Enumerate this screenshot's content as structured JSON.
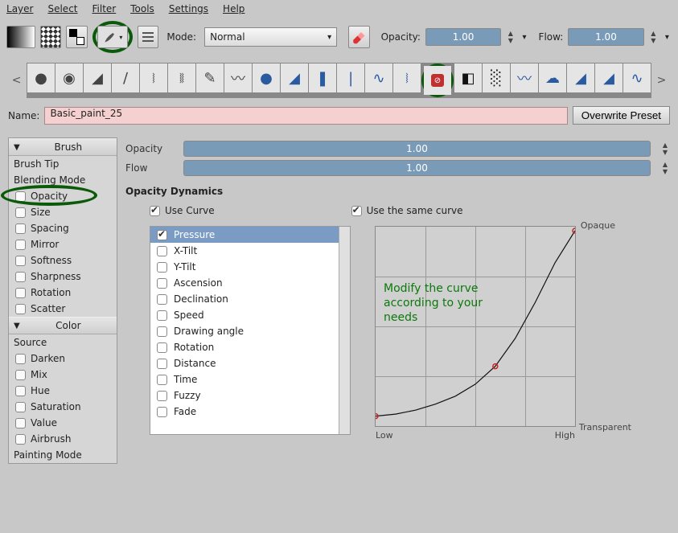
{
  "menubar": [
    "Layer",
    "Select",
    "Filter",
    "Tools",
    "Settings",
    "Help"
  ],
  "toolbar": {
    "mode_label": "Mode:",
    "mode_value": "Normal",
    "opacity_label": "Opacity:",
    "opacity_value": "1.00",
    "flow_label": "Flow:",
    "flow_value": "1.00"
  },
  "name_row": {
    "label": "Name:",
    "value": "Basic_paint_25",
    "overwrite": "Overwrite Preset"
  },
  "left": {
    "brush_header": "Brush",
    "brush_tip": "Brush Tip",
    "blending_mode": "Blending Mode",
    "opacity": "Opacity",
    "size": "Size",
    "spacing": "Spacing",
    "mirror": "Mirror",
    "softness": "Softness",
    "sharpness": "Sharpness",
    "rotation": "Rotation",
    "scatter": "Scatter",
    "color_header": "Color",
    "source": "Source",
    "darken": "Darken",
    "mix": "Mix",
    "hue": "Hue",
    "saturation": "Saturation",
    "value": "Value",
    "airbrush": "Airbrush",
    "painting_mode": "Painting Mode"
  },
  "right": {
    "opacity_label": "Opacity",
    "opacity_value": "1.00",
    "flow_label": "Flow",
    "flow_value": "1.00",
    "dynamics_title": "Opacity Dynamics",
    "use_curve": "Use Curve",
    "use_same_curve": "Use the same curve",
    "params": [
      "Pressure",
      "X-Tilt",
      "Y-Tilt",
      "Ascension",
      "Declination",
      "Speed",
      "Drawing angle",
      "Rotation",
      "Distance",
      "Time",
      "Fuzzy",
      "Fade"
    ],
    "annotation": "Modify the curve according to your needs",
    "axis": {
      "opaque": "Opaque",
      "transparent": "Transparent",
      "low": "Low",
      "high": "High"
    }
  },
  "chart_data": {
    "type": "line",
    "title": "Opacity Dynamics Curve",
    "xlabel": "Pressure",
    "ylabel": "Opacity",
    "xlim": [
      0,
      1
    ],
    "ylim": [
      0,
      1
    ],
    "x_ticks": [
      "Low",
      "High"
    ],
    "y_ticks": [
      "Transparent",
      "Opaque"
    ],
    "control_points": [
      {
        "x": 0.0,
        "y": 0.05
      },
      {
        "x": 0.6,
        "y": 0.3
      },
      {
        "x": 1.0,
        "y": 0.98
      }
    ],
    "series": [
      {
        "name": "curve",
        "x": [
          0.0,
          0.1,
          0.2,
          0.3,
          0.4,
          0.5,
          0.6,
          0.7,
          0.8,
          0.9,
          1.0
        ],
        "y": [
          0.05,
          0.06,
          0.08,
          0.11,
          0.15,
          0.21,
          0.3,
          0.44,
          0.62,
          0.82,
          0.98
        ]
      }
    ]
  }
}
